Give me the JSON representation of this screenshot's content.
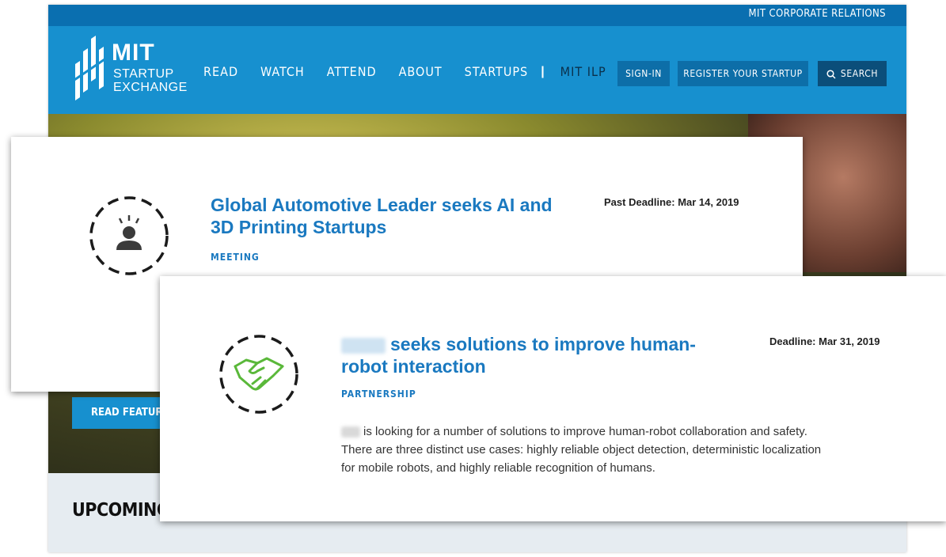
{
  "site": {
    "top_link": "MIT CORPORATE RELATIONS",
    "logo": {
      "line1": "MIT",
      "line2": "STARTUP",
      "line3": "EXCHANGE"
    },
    "nav": [
      "READ",
      "WATCH",
      "ATTEND",
      "ABOUT",
      "STARTUPS"
    ],
    "nav_separator": "|",
    "nav_highlight": "MIT ILP",
    "signin": "SIGN-IN",
    "register": "REGISTER YOUR STARTUP",
    "search": "SEARCH",
    "read_button": "READ FEATURI",
    "section_heading": "UPCOMING"
  },
  "cards": [
    {
      "title_line1": "Global Automotive Leader seeks AI and",
      "title_line2": "3D Printing Startups",
      "type": "MEETING",
      "deadline": "Past Deadline: Mar 14, 2019",
      "icon": "person-idea-icon"
    },
    {
      "title_line1": "seeks solutions to improve human-",
      "title_line2": "robot interaction",
      "type": "PARTNERSHIP",
      "deadline": "Deadline: Mar 31, 2019",
      "desc_line1": "is looking for a number of solutions to improve human-robot collaboration and safety.",
      "desc_line2": "There are three distinct use cases: highly reliable object detection, deterministic localization",
      "desc_line3": "for mobile robots, and highly reliable recognition of humans.",
      "icon": "handshake-icon"
    }
  ],
  "colors": {
    "brand_blue": "#1790cf",
    "dark_blue": "#0a6fb0",
    "link_blue": "#1a79c0",
    "handshake_green": "#5ab83a"
  }
}
